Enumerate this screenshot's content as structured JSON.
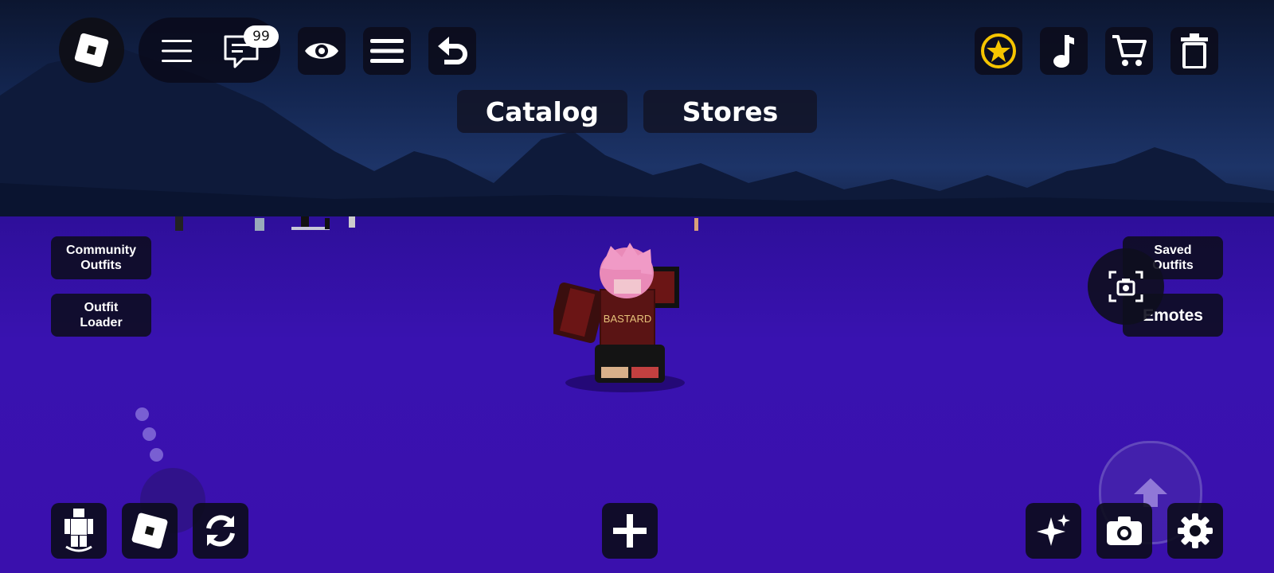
{
  "top_bar": {
    "chat_badge": "99",
    "icons": [
      "roblox-logo-icon",
      "hamburger-menu-icon",
      "chat-icon",
      "eye-icon",
      "list-icon",
      "undo-icon"
    ],
    "right_icons": [
      "star-coin-icon",
      "music-note-icon",
      "cart-icon",
      "trash-icon"
    ],
    "star_color": "#f5c400"
  },
  "tabs": {
    "catalog": "Catalog",
    "stores": "Stores"
  },
  "left_buttons": {
    "community_outfits": "Community\nOutfits",
    "outfit_loader": "Outfit\nLoader"
  },
  "right_buttons": {
    "saved_outfits": "Saved\nOutfits",
    "emotes": "Emotes"
  },
  "bottom_bar": {
    "left_icons": [
      "avatar-icon",
      "roblox-logo-icon",
      "refresh-icon"
    ],
    "center_icon": "plus-icon",
    "right_icons": [
      "sparkles-icon",
      "camera-icon",
      "settings-gear-icon"
    ],
    "jump_icon": "up-arrow-icon"
  },
  "character": {
    "shirt_text": "BASTARD",
    "hair_color": "#e98ab8",
    "shirt_color": "#5a1414"
  },
  "colors": {
    "ground": "#3a10ad",
    "sky": "#13254f",
    "button_bg": "#0c0c1c"
  }
}
